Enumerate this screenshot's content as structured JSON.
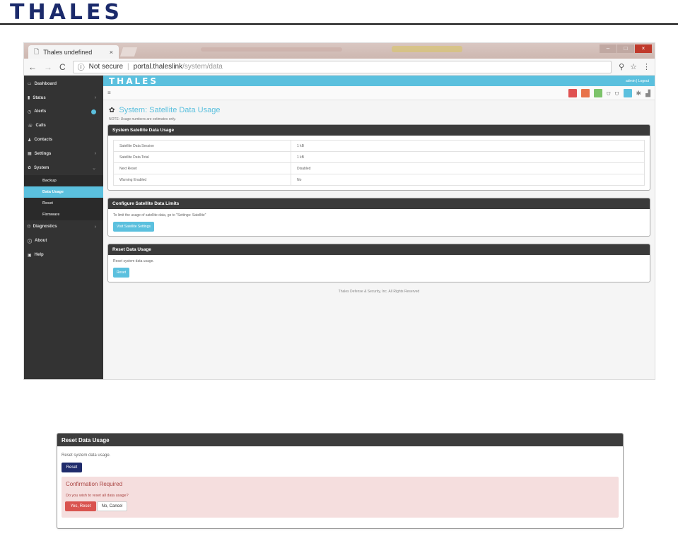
{
  "doc": {
    "logo": "THALES"
  },
  "browser": {
    "tab_title": "Thales undefined",
    "tab_close": "×",
    "not_secure": "Not secure",
    "url_host": "portal.thaleslink",
    "url_path": "/system/data"
  },
  "app": {
    "brand": "THALES",
    "user": "admin | Logout",
    "sidebar": [
      {
        "label": "Dashboard",
        "icon": "dashboard-icon",
        "glyph": "▭"
      },
      {
        "label": "Status",
        "icon": "bar-chart-icon",
        "glyph": "▮",
        "chevron": "›"
      },
      {
        "label": "Alerts",
        "icon": "alarm-icon",
        "glyph": "◷"
      },
      {
        "label": "Calls",
        "icon": "phone-icon",
        "glyph": "☏"
      },
      {
        "label": "Contacts",
        "icon": "contacts-icon",
        "glyph": "♟"
      },
      {
        "label": "Settings",
        "icon": "settings-icon",
        "glyph": "▦",
        "chevron": "›"
      },
      {
        "label": "System",
        "icon": "gear-icon",
        "glyph": "✿",
        "chevron": "⌄"
      }
    ],
    "sidebar_sub": [
      {
        "label": "Backup"
      },
      {
        "label": "Data Usage"
      },
      {
        "label": "Reset"
      },
      {
        "label": "Firmware"
      }
    ],
    "sidebar_after": [
      {
        "label": "Diagnostics",
        "icon": "camera-icon",
        "glyph": "◘",
        "chevron": "›"
      },
      {
        "label": "About",
        "icon": "info-icon",
        "glyph": "ⓘ"
      },
      {
        "label": "Help",
        "icon": "help-icon",
        "glyph": "▣"
      }
    ],
    "page_title": "System: Satellite Data Usage",
    "note": "NOTE: Usage numbers are estimates only.",
    "usage_panel": {
      "title": "System Satellite Data Usage",
      "rows": [
        {
          "label": "Satellite Data Session",
          "value": "1 kB"
        },
        {
          "label": "Satellite Data Total",
          "value": "1 kB"
        },
        {
          "label": "Next Reset",
          "value": "Disabled"
        },
        {
          "label": "Warning Enabled",
          "value": "No"
        }
      ]
    },
    "limits_panel": {
      "title": "Configure Satellite Data Limits",
      "text": "To limit the usage of satellite data, go to \"Settings: Satellite\"",
      "button": "Visit Satellite Settings"
    },
    "reset_panel": {
      "title": "Reset Data Usage",
      "text": "Reset system data usage.",
      "button": "Reset"
    },
    "footer": "Thales Defense & Security, Inc. All Rights Reserved"
  },
  "zoom": {
    "title": "Reset Data Usage",
    "text": "Reset system data usage.",
    "reset_button": "Reset",
    "confirm_title": "Confirmation Required",
    "confirm_question": "Do you wish to reset all data usage?",
    "yes_button": "Yes, Reset",
    "no_button": "No, Cancel"
  },
  "colors": {
    "accent": "#5bc0de",
    "dark": "#333333",
    "danger": "#d9534f",
    "navy": "#1f2b6b"
  }
}
